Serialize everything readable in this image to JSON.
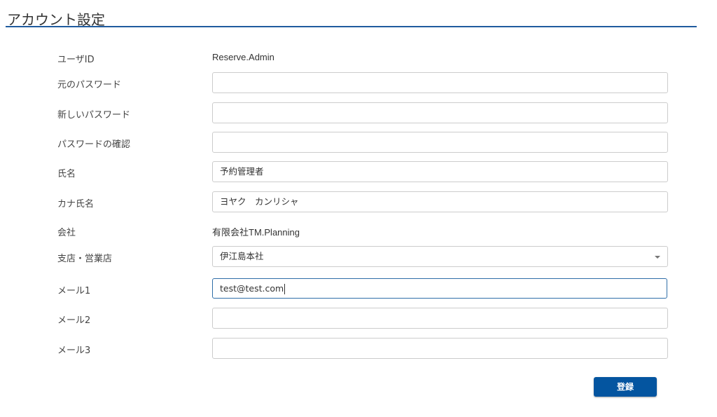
{
  "header": {
    "title": "アカウント設定"
  },
  "form": {
    "user_id": {
      "label": "ユーザID",
      "value": "Reserve.Admin"
    },
    "old_password": {
      "label": "元のパスワード",
      "value": ""
    },
    "new_password": {
      "label": "新しいパスワード",
      "value": ""
    },
    "confirm_password": {
      "label": "パスワードの確認",
      "value": ""
    },
    "name": {
      "label": "氏名",
      "value": "予約管理者"
    },
    "kana_name": {
      "label": "カナ氏名",
      "value": "ヨヤク　カンリシャ"
    },
    "company": {
      "label": "会社",
      "value": "有限会社TM.Planning"
    },
    "branch": {
      "label": "支店・営業店",
      "value": "伊江島本社"
    },
    "mail1": {
      "label": "メール1",
      "value": "test@test.com"
    },
    "mail2": {
      "label": "メール2",
      "value": ""
    },
    "mail3": {
      "label": "メール3",
      "value": ""
    }
  },
  "actions": {
    "submit_label": "登録"
  },
  "colors": {
    "accent": "#0455a0",
    "title_line": "#1f5b9e"
  }
}
